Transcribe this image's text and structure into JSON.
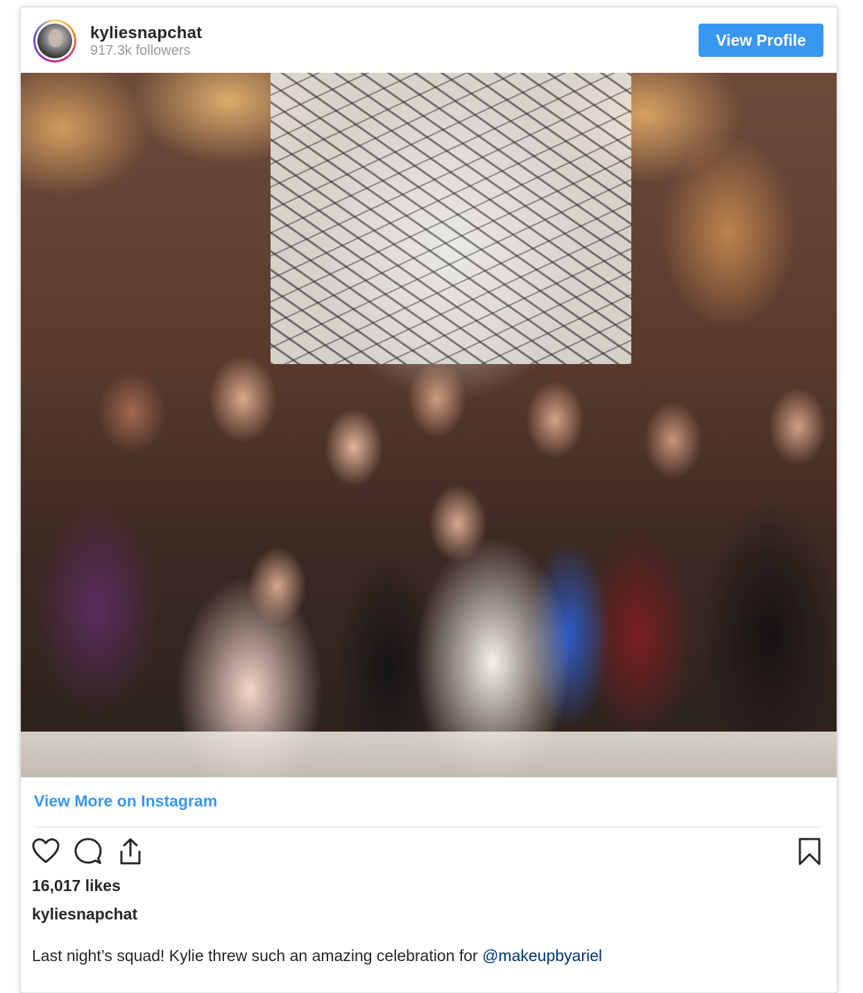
{
  "header": {
    "username": "kyliesnapchat",
    "followers": "917.3k followers",
    "view_profile_label": "View Profile"
  },
  "post": {
    "view_more_label": "View More on Instagram",
    "likes": "16,017 likes",
    "caption_username": "kyliesnapchat",
    "caption_text": "Last night’s squad! Kylie threw such an amazing celebration for ",
    "caption_mention": "@makeupbyariel"
  },
  "icons": {
    "like": "heart-icon",
    "comment": "comment-icon",
    "share": "share-icon",
    "save": "bookmark-icon"
  },
  "colors": {
    "accent_blue": "#3897f0",
    "mention": "#003569",
    "text": "#262626",
    "muted": "#999999"
  }
}
